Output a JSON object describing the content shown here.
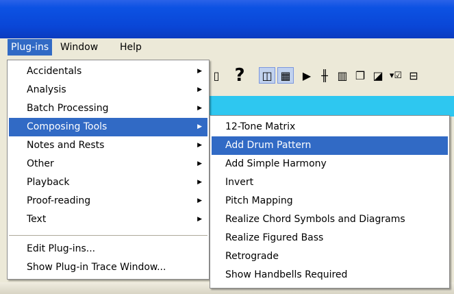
{
  "menubar": {
    "items": [
      {
        "label": "Plug-ins"
      },
      {
        "label": "Window"
      },
      {
        "label": "Help"
      }
    ]
  },
  "toolbar": {
    "icons": [
      "document-icon",
      "help-icon",
      "page-view-icon",
      "grid-view-icon",
      "play-icon",
      "mixer-icon",
      "keyboard-icon",
      "pages-icon",
      "color-icon",
      "filter-icon",
      "layout-icon"
    ]
  },
  "plugins_menu": {
    "items": [
      {
        "label": "Accidentals",
        "submenu": true
      },
      {
        "label": "Analysis",
        "submenu": true
      },
      {
        "label": "Batch Processing",
        "submenu": true
      },
      {
        "label": "Composing Tools",
        "submenu": true,
        "highlighted": true
      },
      {
        "label": "Notes and Rests",
        "submenu": true
      },
      {
        "label": "Other",
        "submenu": true
      },
      {
        "label": "Playback",
        "submenu": true
      },
      {
        "label": "Proof-reading",
        "submenu": true
      },
      {
        "label": "Text",
        "submenu": true
      }
    ],
    "bottom_items": [
      {
        "label": "Edit Plug-ins..."
      },
      {
        "label": "Show Plug-in Trace Window..."
      }
    ]
  },
  "composing_tools_menu": {
    "items": [
      {
        "label": "12-Tone Matrix"
      },
      {
        "label": "Add Drum Pattern",
        "highlighted": true
      },
      {
        "label": "Add Simple Harmony"
      },
      {
        "label": "Invert"
      },
      {
        "label": "Pitch Mapping"
      },
      {
        "label": "Realize Chord Symbols and Diagrams"
      },
      {
        "label": "Realize Figured Bass"
      },
      {
        "label": "Retrograde"
      },
      {
        "label": "Show Handbells Required"
      }
    ]
  },
  "colors": {
    "titlebar": "#0a46d6",
    "highlight": "#316ac5",
    "cyan": "#2ec7f0"
  }
}
